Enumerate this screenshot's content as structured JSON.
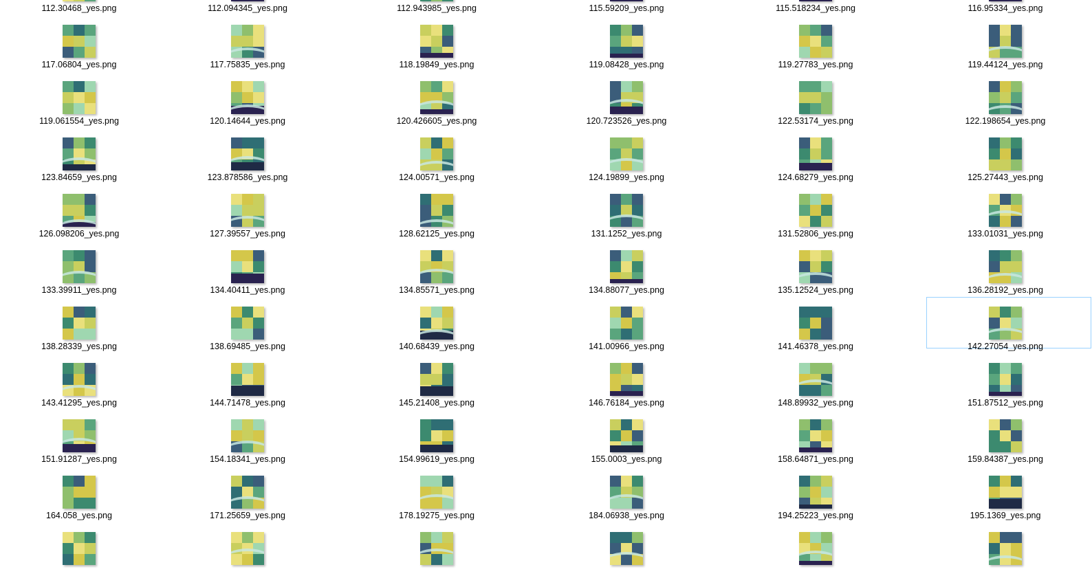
{
  "window": {
    "view": "Large icons"
  },
  "colors": {
    "selection_border": "#99d1ff",
    "palette": [
      "#3b5d7a",
      "#2f6e74",
      "#3c8a6f",
      "#5aa57d",
      "#8fbf6d",
      "#c9cf5e",
      "#d4c74a",
      "#e9e07c",
      "#9fd7b0",
      "#45325e"
    ]
  },
  "rows": [
    [
      "112.30468_yes.png",
      "112.094345_yes.png",
      "112.943985_yes.png",
      "115.59209_yes.png",
      "115.518234_yes.png",
      "116.95334_yes.png"
    ],
    [
      "117.06804_yes.png",
      "117.75835_yes.png",
      "118.19849_yes.png",
      "119.08428_yes.png",
      "119.27783_yes.png",
      "119.44124_yes.png"
    ],
    [
      "119.061554_yes.png",
      "120.14644_yes.png",
      "120.426605_yes.png",
      "120.723526_yes.png",
      "122.53174_yes.png",
      "122.198654_yes.png"
    ],
    [
      "123.84659_yes.png",
      "123.878586_yes.png",
      "124.00571_yes.png",
      "124.19899_yes.png",
      "124.68279_yes.png",
      "125.27443_yes.png"
    ],
    [
      "126.098206_yes.png",
      "127.39557_yes.png",
      "128.62125_yes.png",
      "131.1252_yes.png",
      "131.52806_yes.png",
      "133.01031_yes.png"
    ],
    [
      "133.39911_yes.png",
      "134.40411_yes.png",
      "134.85571_yes.png",
      "134.88077_yes.png",
      "135.12524_yes.png",
      "136.28192_yes.png"
    ],
    [
      "138.28339_yes.png",
      "138.69485_yes.png",
      "140.68439_yes.png",
      "141.00966_yes.png",
      "141.46378_yes.png",
      "142.27054_yes.png"
    ],
    [
      "143.41295_yes.png",
      "144.71478_yes.png",
      "145.21408_yes.png",
      "146.76184_yes.png",
      "148.89932_yes.png",
      "151.87512_yes.png"
    ],
    [
      "151.91287_yes.png",
      "154.18341_yes.png",
      "154.99619_yes.png",
      "155.0003_yes.png",
      "158.64871_yes.png",
      "159.84387_yes.png"
    ],
    [
      "164.058_yes.png",
      "171.25659_yes.png",
      "178.19275_yes.png",
      "184.06938_yes.png",
      "194.25223_yes.png",
      "195.1369_yes.png"
    ]
  ],
  "selected_file": "142.27054_yes.png"
}
